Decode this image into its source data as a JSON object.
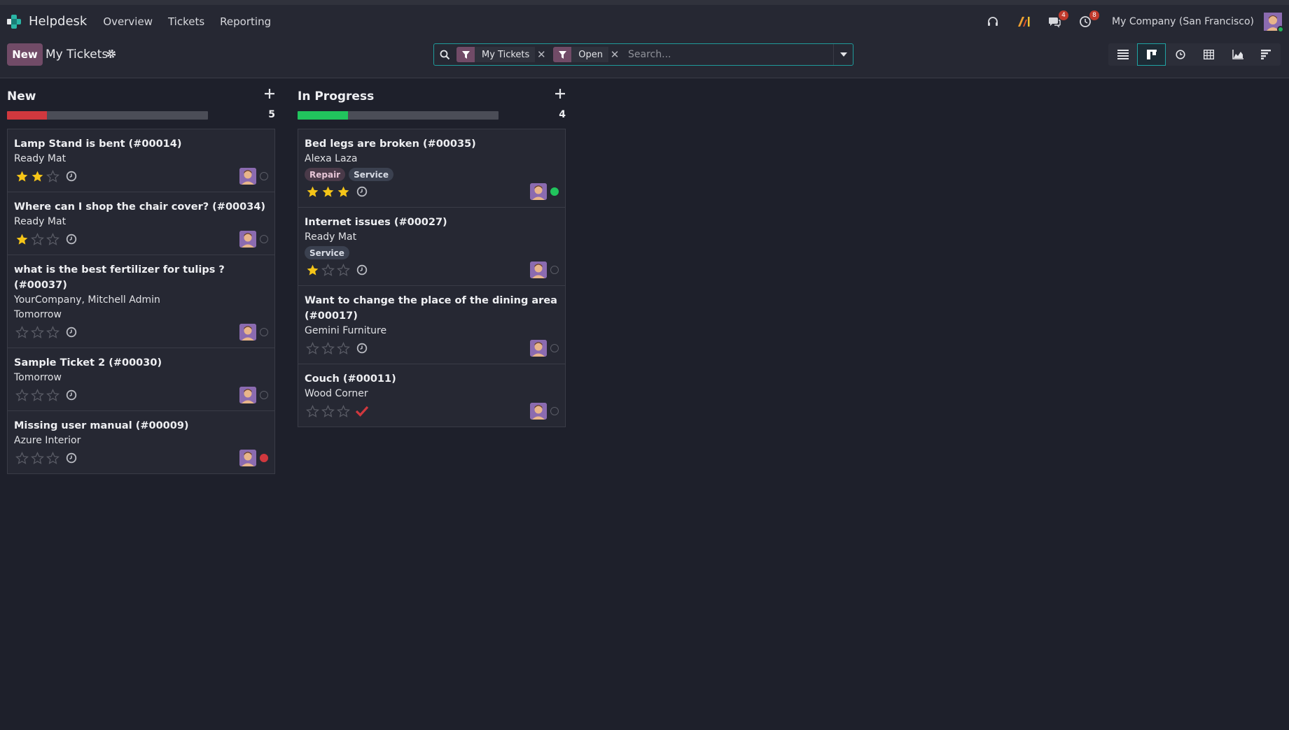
{
  "navbar": {
    "app_name": "Helpdesk",
    "menu": [
      "Overview",
      "Tickets",
      "Reporting"
    ],
    "messages_badge": "4",
    "activities_badge": "8",
    "company": "My Company (San Francisco)"
  },
  "control": {
    "new_label": "New",
    "title": "My Tickets",
    "facets": [
      "My Tickets",
      "Open"
    ],
    "search_placeholder": "Search..."
  },
  "colors": {
    "accent": "#714b67",
    "focus": "#1fa3a3",
    "progress_red": "#d0383e",
    "progress_green": "#21c45d",
    "star": "#f5c518"
  },
  "columns": [
    {
      "title": "New",
      "count": "5",
      "progress": {
        "fraction": 0.2,
        "color": "#d0383e"
      },
      "cards": [
        {
          "title": "Lamp Stand is bent (#00014)",
          "lines": [
            "Ready Mat"
          ],
          "tags": [],
          "stars": 2,
          "activity": "clock-icon",
          "state": "grey"
        },
        {
          "title": "Where can I shop the chair cover? (#00034)",
          "lines": [
            "Ready Mat"
          ],
          "tags": [],
          "stars": 1,
          "activity": "clock-icon",
          "state": "grey"
        },
        {
          "title": "what is the best fertilizer for tulips ? (#00037)",
          "lines": [
            "YourCompany, Mitchell Admin",
            "Tomorrow"
          ],
          "tags": [],
          "stars": 0,
          "activity": "clock-icon",
          "state": "grey"
        },
        {
          "title": "Sample Ticket 2 (#00030)",
          "lines": [
            "Tomorrow"
          ],
          "tags": [],
          "stars": 0,
          "activity": "clock-icon",
          "state": "grey"
        },
        {
          "title": "Missing user manual (#00009)",
          "lines": [
            "Azure Interior"
          ],
          "tags": [],
          "stars": 0,
          "activity": "clock-icon",
          "state": "red"
        }
      ]
    },
    {
      "title": "In Progress",
      "count": "4",
      "progress": {
        "fraction": 0.25,
        "color": "#21c45d"
      },
      "cards": [
        {
          "title": "Bed legs are broken (#00035)",
          "lines": [
            "Alexa Laza"
          ],
          "tags": [
            "Repair",
            "Service"
          ],
          "stars": 3,
          "activity": "clock-icon",
          "state": "green"
        },
        {
          "title": "Internet issues (#00027)",
          "lines": [
            "Ready Mat"
          ],
          "tags": [
            "Service"
          ],
          "stars": 1,
          "activity": "clock-icon",
          "state": "grey"
        },
        {
          "title": "Want to change the place of the dining area (#00017)",
          "lines": [
            "Gemini Furniture"
          ],
          "tags": [],
          "stars": 0,
          "activity": "clock-icon",
          "state": "grey"
        },
        {
          "title": "Couch (#00011)",
          "lines": [
            "Wood Corner"
          ],
          "tags": [],
          "stars": 0,
          "activity": "check-icon",
          "state": "grey"
        }
      ]
    }
  ]
}
